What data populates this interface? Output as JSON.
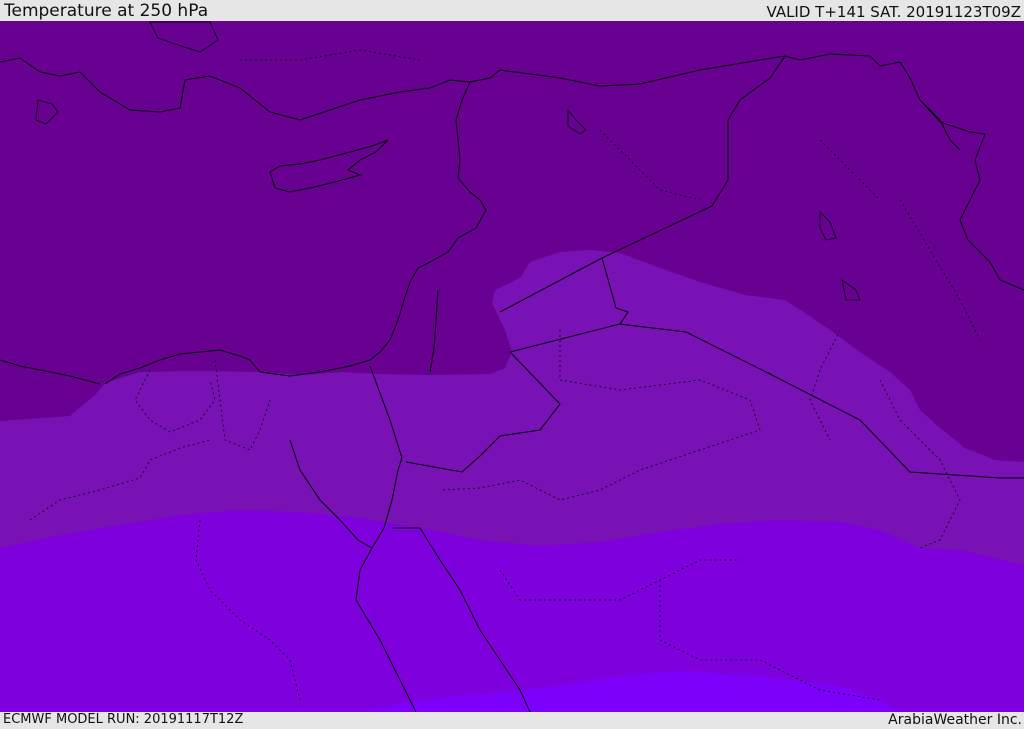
{
  "header": {
    "title": "Temperature at 250 hPa",
    "valid_time": "VALID T+141 SAT. 20191123T09Z"
  },
  "footer": {
    "model_run": "ECMWF MODEL RUN: 20191117T12Z",
    "credit": "ArabiaWeather Inc."
  },
  "map": {
    "parameter": "temperature",
    "level": "250 hPa",
    "colors": {
      "band_coldest": "#680092",
      "band_mid": "#7812b4",
      "band_warm": "#7e00dc",
      "band_warmest": "#7c00fa",
      "coastline": "#000000",
      "border": "#000000"
    }
  }
}
